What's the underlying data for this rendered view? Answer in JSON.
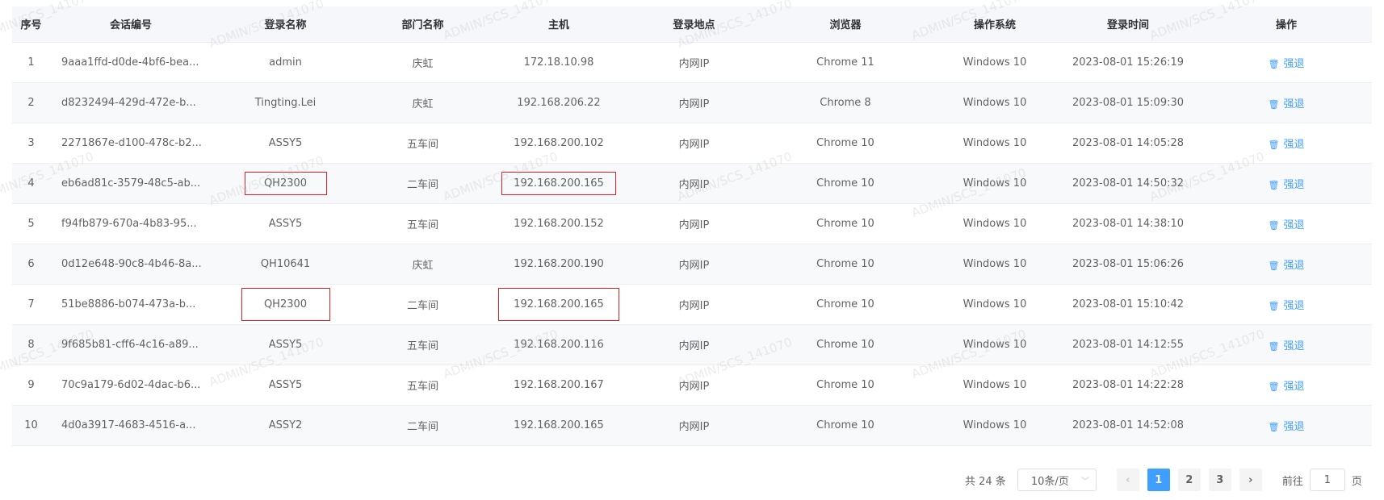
{
  "table": {
    "headers": [
      "序号",
      "会话编号",
      "登录名称",
      "部门名称",
      "主机",
      "登录地点",
      "浏览器",
      "操作系统",
      "登录时间",
      "操作"
    ],
    "action_label": "强退",
    "rows": [
      {
        "idx": "1",
        "session": "9aaa1ffd-d0de-4bf6-bea...",
        "login": "admin",
        "dept": "庆虹",
        "host": "172.18.10.98",
        "location": "内网IP",
        "browser": "Chrome 11",
        "os": "Windows 10",
        "time": "2023-08-01 15:26:19"
      },
      {
        "idx": "2",
        "session": "d8232494-429d-472e-b...",
        "login": "Tingting.Lei",
        "dept": "庆虹",
        "host": "192.168.206.22",
        "location": "内网IP",
        "browser": "Chrome 8",
        "os": "Windows 10",
        "time": "2023-08-01 15:09:30"
      },
      {
        "idx": "3",
        "session": "2271867e-d100-478c-b2...",
        "login": "ASSY5",
        "dept": "五车间",
        "host": "192.168.200.102",
        "location": "内网IP",
        "browser": "Chrome 10",
        "os": "Windows 10",
        "time": "2023-08-01 14:05:28"
      },
      {
        "idx": "4",
        "session": "eb6ad81c-3579-48c5-ab...",
        "login": "QH2300",
        "dept": "二车间",
        "host": "192.168.200.165",
        "location": "内网IP",
        "browser": "Chrome 10",
        "os": "Windows 10",
        "time": "2023-08-01 14:50:32"
      },
      {
        "idx": "5",
        "session": "f94fb879-670a-4b83-95...",
        "login": "ASSY5",
        "dept": "五车间",
        "host": "192.168.200.152",
        "location": "内网IP",
        "browser": "Chrome 10",
        "os": "Windows 10",
        "time": "2023-08-01 14:38:10"
      },
      {
        "idx": "6",
        "session": "0d12e648-90c8-4b46-8a...",
        "login": "QH10641",
        "dept": "庆虹",
        "host": "192.168.200.190",
        "location": "内网IP",
        "browser": "Chrome 10",
        "os": "Windows 10",
        "time": "2023-08-01 15:06:26"
      },
      {
        "idx": "7",
        "session": "51be8886-b074-473a-b...",
        "login": "QH2300",
        "dept": "二车间",
        "host": "192.168.200.165",
        "location": "内网IP",
        "browser": "Chrome 10",
        "os": "Windows 10",
        "time": "2023-08-01 15:10:42"
      },
      {
        "idx": "8",
        "session": "9f685b81-cff6-4c16-a89...",
        "login": "ASSY5",
        "dept": "五车间",
        "host": "192.168.200.116",
        "location": "内网IP",
        "browser": "Chrome 10",
        "os": "Windows 10",
        "time": "2023-08-01 14:12:55"
      },
      {
        "idx": "9",
        "session": "70c9a179-6d02-4dac-b6...",
        "login": "ASSY5",
        "dept": "五车间",
        "host": "192.168.200.167",
        "location": "内网IP",
        "browser": "Chrome 10",
        "os": "Windows 10",
        "time": "2023-08-01 14:22:28"
      },
      {
        "idx": "10",
        "session": "4d0a3917-4683-4516-a...",
        "login": "ASSY2",
        "dept": "二车间",
        "host": "192.168.200.165",
        "location": "内网IP",
        "browser": "Chrome 10",
        "os": "Windows 10",
        "time": "2023-08-01 14:52:08"
      }
    ]
  },
  "watermark": "ADMIN/SCS_141070",
  "pagination": {
    "total": "共 24 条",
    "page_size": "10条/页",
    "prev": "‹",
    "pages": [
      "1",
      "2",
      "3"
    ],
    "next": "›",
    "goto_label": "前往",
    "goto_value": "1",
    "page_suffix": "页"
  },
  "colors": {
    "accent": "#409eff",
    "highlight_box": "#e02020"
  }
}
